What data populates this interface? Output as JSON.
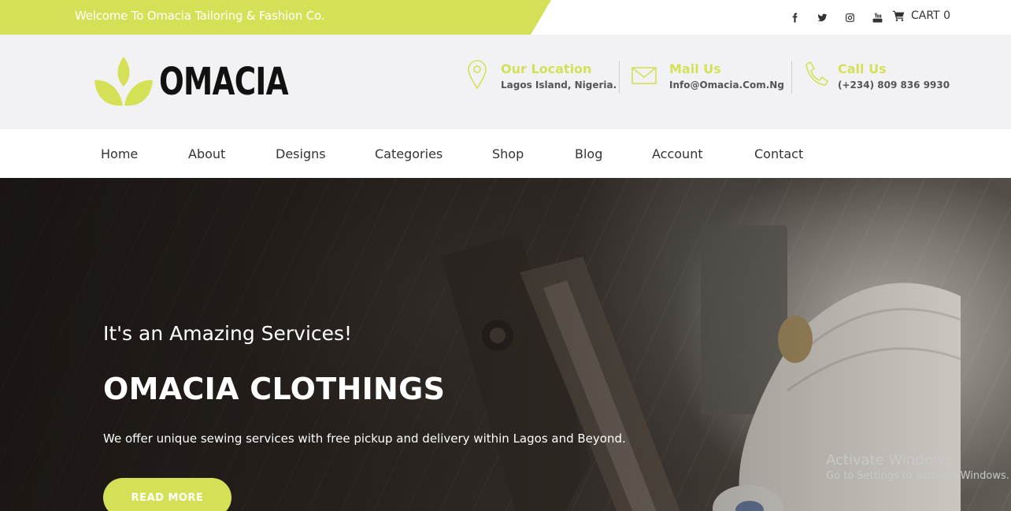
{
  "topbar": {
    "welcome": "Welcome To Omacia Tailoring & Fashion Co.",
    "socials": [
      "facebook-icon",
      "twitter-icon",
      "instagram-icon",
      "youtube-icon"
    ],
    "cart_label": "CART 0"
  },
  "header": {
    "logo_text": "OMACIA",
    "location": {
      "title": "Our Location",
      "value": "Lagos Island, Nigeria."
    },
    "mail": {
      "title": "Mail Us",
      "value": "Info@Omacia.Com.Ng"
    },
    "call": {
      "title": "Call Us",
      "value": "(+234) 809 836 9930"
    }
  },
  "nav": {
    "items": [
      "Home",
      "About",
      "Designs",
      "Categories",
      "Shop",
      "Blog",
      "Account",
      "Contact"
    ]
  },
  "hero": {
    "subtitle": "It's an Amazing Services!",
    "title": "OMACIA CLOTHINGS",
    "description": "We offer unique sewing services with free pickup and delivery within Lagos and Beyond.",
    "button": "READ MORE"
  },
  "watermark": {
    "line1": "Activate Windows",
    "line2": "Go to Settings to activate Windows."
  },
  "colors": {
    "accent": "#d4e157",
    "header_bg": "#f2f2f4"
  }
}
